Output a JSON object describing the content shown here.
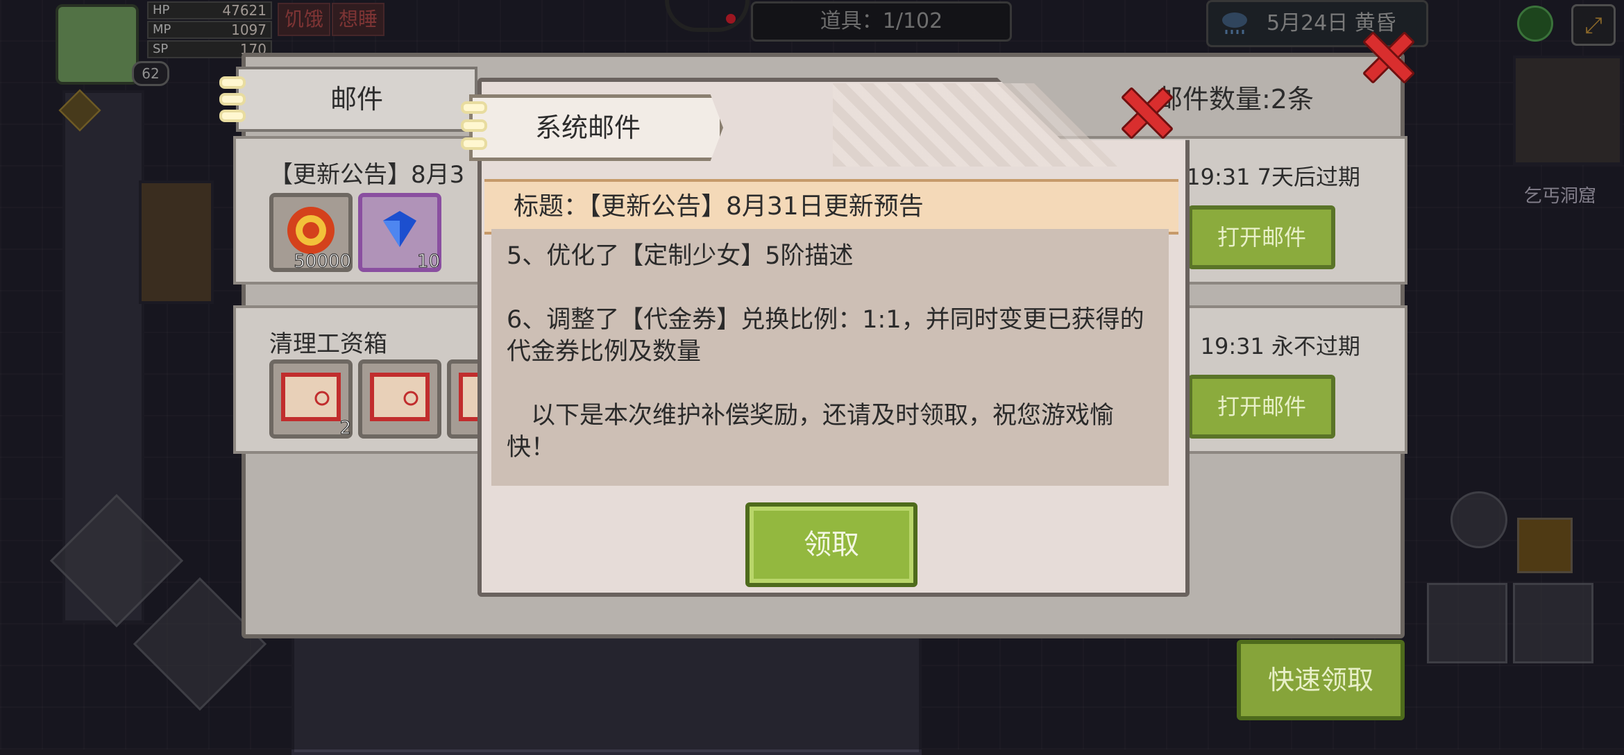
{
  "hud": {
    "level": "62",
    "stats": [
      {
        "label": "HP",
        "value": "47621"
      },
      {
        "label": "MP",
        "value": "1097"
      },
      {
        "label": "SP",
        "value": "170"
      }
    ],
    "status_tags": [
      "饥饿",
      "想睡"
    ],
    "item_counter": "道具：1/102",
    "date_time": "5月24日  黄昏",
    "map_name": "乞丐洞窟"
  },
  "mail_panel": {
    "title": "邮件",
    "count": "邮件数量:2条",
    "rows": [
      {
        "title": "【更新公告】8月3",
        "time": "19:31  7天后过期",
        "button": "打开邮件",
        "rewards": [
          {
            "icon": "gold-coin-icon",
            "qty": "50000"
          },
          {
            "icon": "diamond-icon",
            "qty": "10"
          }
        ]
      },
      {
        "title": "清理工资箱",
        "time": "19:31  永不过期",
        "button": "打开邮件",
        "rewards": [
          {
            "icon": "ticket-icon",
            "qty": "2"
          },
          {
            "icon": "ticket-icon",
            "qty": ""
          },
          {
            "icon": "ticket-icon",
            "qty": ""
          }
        ]
      }
    ],
    "quick_claim": "快速领取"
  },
  "dialog": {
    "tab": "系统邮件",
    "subject": "标题：【更新公告】8月31日更新预告",
    "paragraphs": [
      "5、优化了【定制少女】5阶描述",
      "6、调整了【代金券】兑换比例：1:1，并同时变更已获得的代金券比例及数量",
      "　以下是本次维护补偿奖励，还请及时领取，祝您游戏愉快！"
    ],
    "claim_button": "领取"
  },
  "colors": {
    "button_green": "#8bab3d",
    "close_red": "#d92e2e",
    "subject_banner": "#f4d9b8"
  }
}
